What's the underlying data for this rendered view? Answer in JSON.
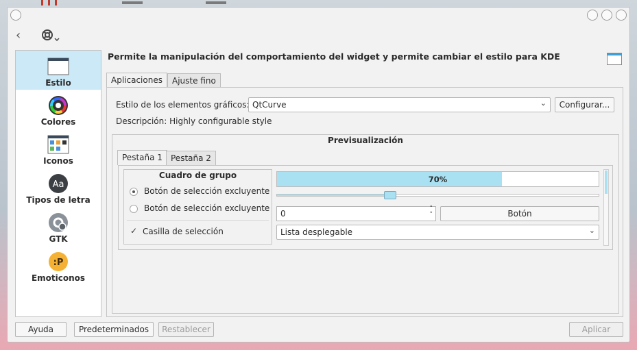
{
  "window": {
    "back_icon": "back-arrow-icon",
    "help_icon": "lifebuoy-icon"
  },
  "sidebar": {
    "items": [
      {
        "label": "Estilo",
        "icon": "window-style-icon",
        "active": true
      },
      {
        "label": "Colores",
        "icon": "color-wheel-icon"
      },
      {
        "label": "Iconos",
        "icon": "icons-icon"
      },
      {
        "label": "Tipos de letra",
        "icon": "fonts-icon"
      },
      {
        "label": "GTK",
        "icon": "gtk-icon"
      },
      {
        "label": "Emoticonos",
        "icon": "emoticons-icon"
      }
    ]
  },
  "main": {
    "heading": "Permite la manipulación del comportamiento del widget y permite cambiar el estilo para KDE",
    "tabs": [
      "Aplicaciones",
      "Ajuste fino"
    ],
    "widget_style_label": "Estilo de los elementos gráficos:",
    "widget_style_value": "QtCurve",
    "configure_button": "Configurar...",
    "description": "Descripción: Highly configurable style",
    "preview": {
      "title": "Previsualización",
      "tabs": [
        "Pestaña 1",
        "Pestaña 2"
      ],
      "group_title": "Cuadro de grupo",
      "radio1": "Botón de selección excluyente",
      "radio2": "Botón de selección excluyente",
      "checkbox": "Casilla de selección",
      "progress_text": "70%",
      "progress_value": 0.7,
      "slider_value": 0.35,
      "spin_value": "0",
      "button": "Botón",
      "dropdown": "Lista desplegable"
    }
  },
  "footer": {
    "help": "Ayuda",
    "defaults": "Predeterminados",
    "reset": "Restablecer",
    "apply": "Aplicar"
  },
  "colors": {
    "accent": "#3da0d8",
    "selection": "#cbe9f7",
    "progress_fill": "#a9e1f3"
  }
}
